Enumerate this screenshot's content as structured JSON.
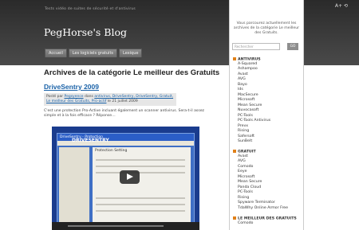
{
  "header": {
    "top_note": "Tests vidéo de suites de sécurité et d'antivirus",
    "blog_title": "PegHorse's Blog",
    "top_right": "A+ ⟲",
    "tabs": [
      "Accueil",
      "Les logiciels gratuits",
      "Lexique"
    ]
  },
  "main": {
    "category_heading": "Archives de la catégorie Le meilleur des Gratuits",
    "post_title": "DriveSentry 2009",
    "meta": {
      "posted_by_prefix": "Posté par ",
      "author": "Pegsyence",
      "in": " dans ",
      "categories": "antivirus, DriveSentry, DriveSentry, Gratuit, Le meilleur des Gratuits, Pro-actif",
      "date": " le 21 juillet 2009"
    },
    "excerpt": "C'est une protection Pro-Active incluant également un scanner antivirus. Sera-t-il assez simple et à la fois efficace ? Réponse…",
    "video": {
      "window_title": "DriveSentry - Protection",
      "brand": "DRIVESENTRY",
      "panel_title": "Protection Setting"
    }
  },
  "sidebar": {
    "intro": "Vous parcourez actuellement les archives de la catégorie Le meilleur des Gratuits.",
    "search_placeholder": "Rechercher",
    "search_button": "GO",
    "sections": [
      {
        "title": "ANTIVIRUS",
        "items": [
          "A-Squared",
          "Ashampoo",
          "Avast",
          "AVG",
          "Bayo",
          "Ids",
          "MacSecure",
          "Microsoft",
          "Mean Secure",
          "Nuvocasoft",
          "PC-Tools",
          "PC-Tools Antivirus",
          "Prevx",
          "Rising",
          "Safersoft",
          "SunBelt"
        ]
      },
      {
        "title": "GRATUIT",
        "items": [
          "Avast",
          "AVG",
          "Comodo",
          "Eeye",
          "Microsoft",
          "Mean Secure",
          "Panda Cloud",
          "PC-Tools",
          "Rising",
          "Spyware Terminator",
          "TdaWhy Online Armor Free"
        ]
      },
      {
        "title": "LE MEILLEUR DES GRATUITS",
        "items": [
          "Comodo"
        ]
      }
    ]
  }
}
